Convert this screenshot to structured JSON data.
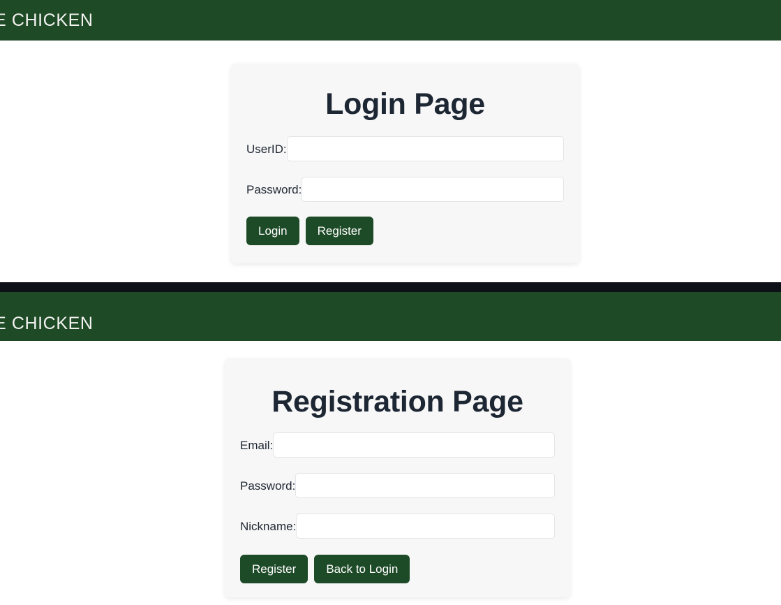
{
  "theme": {
    "header_green": "#1f4a26",
    "button_green": "#1d4a27",
    "card_background": "#f7f7f7",
    "page_background": "#ffffff",
    "separator_dark": "#0d1117",
    "text_dark": "#1d2633",
    "header_text": "#f3f3f1",
    "input_border": "#e2e4e8"
  },
  "header": {
    "brand_visible_text": "E CHICKEN"
  },
  "login": {
    "title": "Login Page",
    "fields": [
      {
        "label": "UserID:",
        "value": "",
        "placeholder": "",
        "type": "text",
        "name": "userid"
      },
      {
        "label": "Password:",
        "value": "",
        "placeholder": "",
        "type": "password",
        "name": "password"
      }
    ],
    "buttons": [
      {
        "label": "Login",
        "name": "login"
      },
      {
        "label": "Register",
        "name": "register"
      }
    ]
  },
  "registration": {
    "title": "Registration Page",
    "fields": [
      {
        "label": "Email:",
        "value": "",
        "placeholder": "",
        "type": "text",
        "name": "email"
      },
      {
        "label": "Password:",
        "value": "",
        "placeholder": "",
        "type": "password",
        "name": "password"
      },
      {
        "label": "Nickname:",
        "value": "",
        "placeholder": "",
        "type": "text",
        "name": "nickname"
      }
    ],
    "buttons": [
      {
        "label": "Register",
        "name": "register"
      },
      {
        "label": "Back to Login",
        "name": "back-to-login"
      }
    ]
  }
}
